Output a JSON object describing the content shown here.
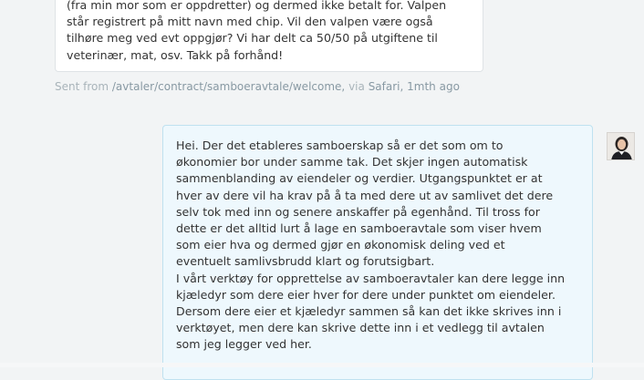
{
  "incoming_message": {
    "lines": [
      "(fra min mor som er oppdretter) og dermed ikke betalt for. Valpen",
      "står registrert på mitt navn med chip. Vil den valpen være også",
      "tilhøre meg ved evt oppgjør? Vi har delt ca 50/50 på utgiftene til",
      "veterinær, mat, osv. Takk på forhånd!"
    ],
    "meta": {
      "prefix": "Sent from",
      "path": "/avtaler/contract/samboeravtale/welcome,",
      "via_label": "via",
      "browser": "Safari,",
      "time": "1mth ago"
    }
  },
  "outgoing_message": {
    "lines": [
      "Hei. Der det etableres samboerskap så er det som om to",
      "økonomier bor under samme tak. Det skjer ingen automatisk",
      "sammenblanding av eiendeler og verdier. Utgangspunktet er at",
      "hver av dere vil ha krav på å ta med dere ut av samlivet det dere",
      "selv tok med inn og senere anskaffer på egenhånd. Til tross for",
      "dette er det alltid lurt å lage en samboeravtale som viser hvem",
      "som eier hva og dermed gjør en økonomisk deling ved et",
      "eventuelt samlivsbrudd klart og forutsigbart.",
      "I vårt verktøy for opprettelse av samboeravtaler kan dere legge inn",
      "kjæledyr som dere eier hver for dere under punktet om eiendeler.",
      "Dersom dere eier et kjæledyr sammen så kan det ikke skrives inn i",
      "verktøyet, men dere kan skrive dette inn i et vedlegg til avtalen",
      "som jeg legger ved her."
    ]
  },
  "colors": {
    "background": "#f2f4f5",
    "incoming_bubble": "#ffffff",
    "outgoing_bubble": "#eef8fd",
    "outgoing_border": "#bfe1f0",
    "meta_text": "#a9b4ba"
  },
  "icons": {
    "agent_avatar": "agent-avatar-photo"
  }
}
